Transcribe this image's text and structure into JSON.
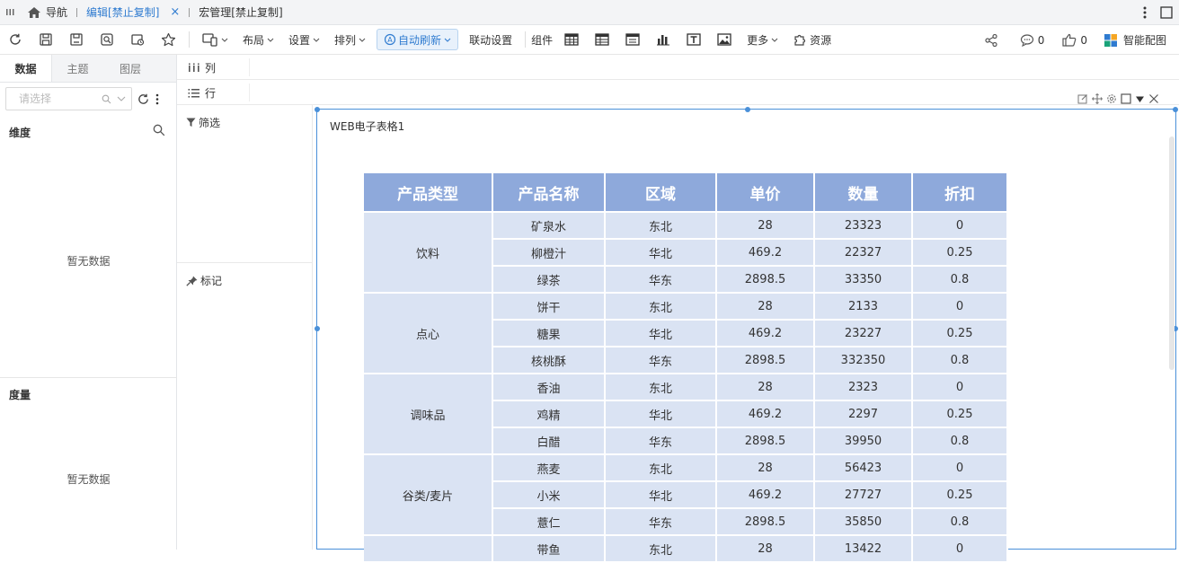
{
  "tabs": {
    "nav_label": "导航",
    "edit_label": "编辑[禁止复制]",
    "close_glyph": "×",
    "macro_label": "宏管理[禁止复制]"
  },
  "toolbar": {
    "layout_label": "布局",
    "settings_label": "设置",
    "arrange_label": "排列",
    "auto_refresh_label": "自动刷新",
    "link_settings_label": "联动设置",
    "components_label": "组件",
    "more_label": "更多",
    "resources_label": "资源",
    "comment_count": "0",
    "like_count": "0",
    "smart_label": "智能配图",
    "accent_color": "#2f7bd0"
  },
  "panel": {
    "tabs": [
      "数据",
      "主题",
      "图层"
    ],
    "search_placeholder": "请选择",
    "dimension_title": "维度",
    "dimension_empty": "暂无数据",
    "measure_title": "度量",
    "measure_empty": "暂无数据"
  },
  "shelves": {
    "columns_label": "列",
    "rows_label": "行",
    "filter_label": "筛选",
    "mark_label": "标记"
  },
  "widget": {
    "title": "WEB电子表格1",
    "header_color": "#8ea9db",
    "cell_color": "#dae3f3"
  },
  "table": {
    "headers": [
      "产品类型",
      "产品名称",
      "区域",
      "单价",
      "数量",
      "折扣"
    ],
    "groups": [
      {
        "type": "饮料",
        "rows": [
          [
            "矿泉水",
            "东北",
            "28",
            "23323",
            "0"
          ],
          [
            "柳橙汁",
            "华北",
            "469.2",
            "22327",
            "0.25"
          ],
          [
            "绿茶",
            "华东",
            "2898.5",
            "33350",
            "0.8"
          ]
        ]
      },
      {
        "type": "点心",
        "rows": [
          [
            "饼干",
            "东北",
            "28",
            "2133",
            "0"
          ],
          [
            "糖果",
            "华北",
            "469.2",
            "23227",
            "0.25"
          ],
          [
            "核桃酥",
            "华东",
            "2898.5",
            "332350",
            "0.8"
          ]
        ]
      },
      {
        "type": "调味品",
        "rows": [
          [
            "香油",
            "东北",
            "28",
            "2323",
            "0"
          ],
          [
            "鸡精",
            "华北",
            "469.2",
            "2297",
            "0.25"
          ],
          [
            "白醋",
            "华东",
            "2898.5",
            "39950",
            "0.8"
          ]
        ]
      },
      {
        "type": "谷类/麦片",
        "rows": [
          [
            "燕麦",
            "东北",
            "28",
            "56423",
            "0"
          ],
          [
            "小米",
            "华北",
            "469.2",
            "27727",
            "0.25"
          ],
          [
            "薏仁",
            "华东",
            "2898.5",
            "35850",
            "0.8"
          ]
        ]
      },
      {
        "type": "",
        "rows": [
          [
            "带鱼",
            "东北",
            "28",
            "13422",
            "0"
          ]
        ]
      }
    ]
  }
}
